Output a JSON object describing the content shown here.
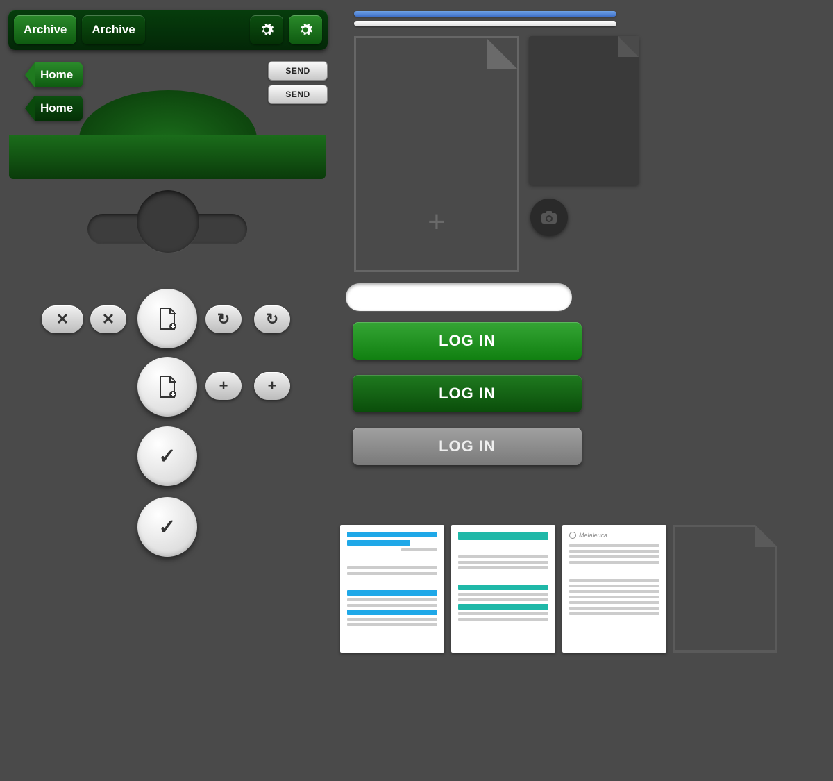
{
  "toolbar": {
    "archive1": "Archive",
    "archive2": "Archive"
  },
  "nav": {
    "home1": "Home",
    "home2": "Home"
  },
  "send": {
    "label1": "SEND",
    "label2": "SEND"
  },
  "login": {
    "l1": "LOG IN",
    "l2": "LOG IN",
    "l3": "LOG IN"
  },
  "thumbnails": {
    "brand": "Melaleuca"
  },
  "icons": {
    "plus": "+",
    "close": "✕",
    "refresh": "↻",
    "check": "✓"
  }
}
